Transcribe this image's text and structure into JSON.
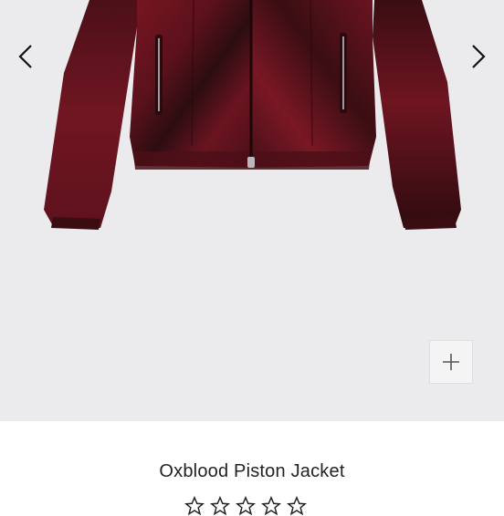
{
  "gallery": {
    "prev_icon": "chevron-left-icon",
    "next_icon": "chevron-right-icon",
    "zoom_icon": "plus-icon",
    "product_image": "oxblood leather jacket"
  },
  "product": {
    "title": "Oxblood Piston Jacket",
    "rating_stars": 5,
    "review_count": ""
  },
  "colors": {
    "background": "#ebebed",
    "leather": "#6e1420",
    "leather_dark": "#2a0c10",
    "text": "#222222"
  }
}
